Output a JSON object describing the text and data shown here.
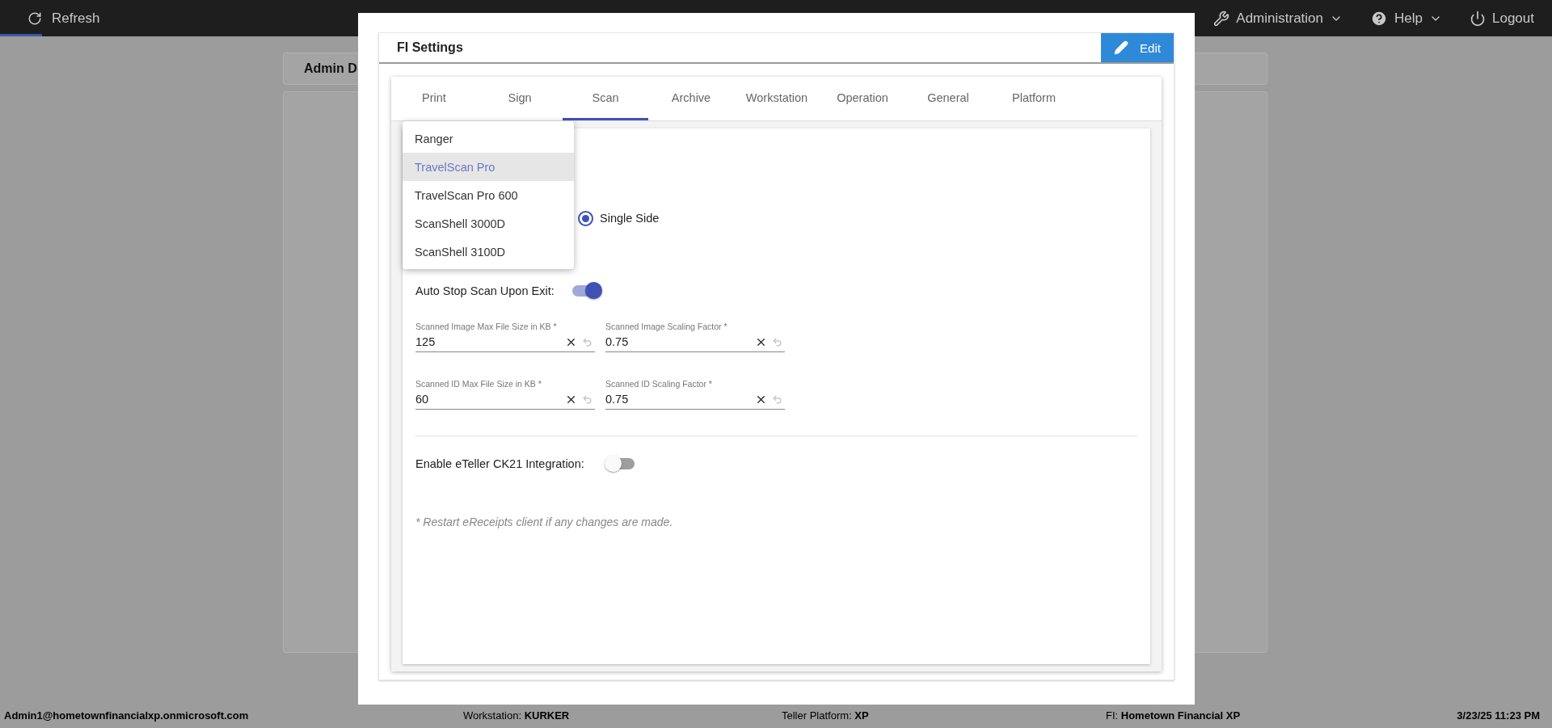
{
  "top_bar": {
    "refresh": "Refresh",
    "menus": [
      {
        "label": "Administration",
        "kind": "dropdown"
      },
      {
        "label": "Help",
        "kind": "dropdown"
      },
      {
        "label": "Logout",
        "kind": "action"
      }
    ]
  },
  "background_panel": {
    "title": "Admin D"
  },
  "dialog": {
    "title": "FI Settings",
    "edit_button": "Edit",
    "tabs": [
      {
        "label": "Print",
        "selected": false
      },
      {
        "label": "Sign",
        "selected": false
      },
      {
        "label": "Scan",
        "selected": true
      },
      {
        "label": "Archive",
        "selected": false
      },
      {
        "label": "Workstation",
        "selected": false
      },
      {
        "label": "Operation",
        "selected": false
      },
      {
        "label": "General",
        "selected": false
      },
      {
        "label": "Platform",
        "selected": false
      }
    ],
    "scanner_menu": {
      "items": [
        {
          "label": "Ranger",
          "selected": false
        },
        {
          "label": "TravelScan Pro",
          "selected": true
        },
        {
          "label": "TravelScan Pro 600",
          "selected": false
        },
        {
          "label": "ScanShell 3000D",
          "selected": false
        },
        {
          "label": "ScanShell 3100D",
          "selected": false
        }
      ]
    },
    "scan_side": {
      "options": [
        {
          "label": "Single Side",
          "selected": true
        }
      ]
    },
    "auto_stop": {
      "label": "Auto Stop Scan Upon Exit:",
      "on": true
    },
    "fields": [
      {
        "label": "Scanned Image Max File Size in KB *",
        "value": "125"
      },
      {
        "label": "Scanned Image Scaling Factor *",
        "value": "0.75"
      },
      {
        "label": "Scanned ID Max File Size in KB *",
        "value": "60"
      },
      {
        "label": "Scanned ID Scaling Factor *",
        "value": "0.75"
      }
    ],
    "eteller": {
      "label": "Enable eTeller CK21 Integration:",
      "on": false
    },
    "note": "* Restart eReceipts client if any changes are made."
  },
  "status_bar": {
    "user": "Admin1@hometownfinancialxp.onmicrosoft.com",
    "workstation": "Workstation: **KURKER**",
    "platform": "Teller Platform: **XP**",
    "fi": "FI: **Hometown Financial XP**",
    "datetime": "3/23/25 11:23 PM"
  }
}
